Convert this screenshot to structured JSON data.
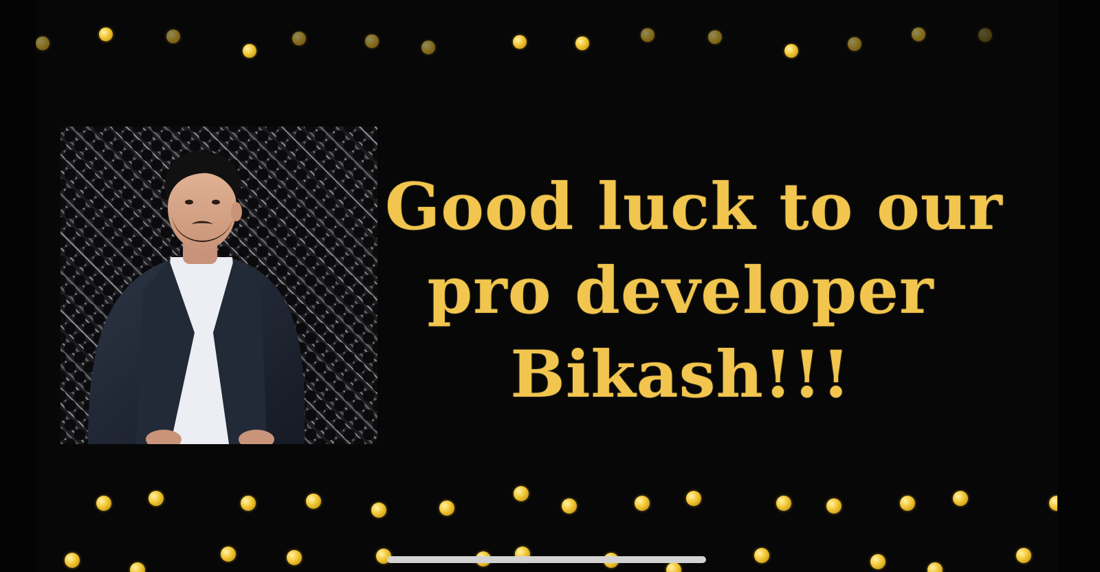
{
  "headline": {
    "line1": "Good luck to our",
    "line2": "pro developer",
    "line3": "Bikash!!!"
  },
  "colors": {
    "background": "#070708",
    "headline_gold": "#f1c54e",
    "dot_gold": "#f2c531",
    "home_indicator": "#d3d3d3"
  },
  "photo": {
    "subject": "man in dark suit jacket and white shirt",
    "backdrop": "dark lattice wall"
  },
  "icons": {
    "confetti": "gold-dot-confetti",
    "home_indicator": "home-indicator-bar"
  }
}
